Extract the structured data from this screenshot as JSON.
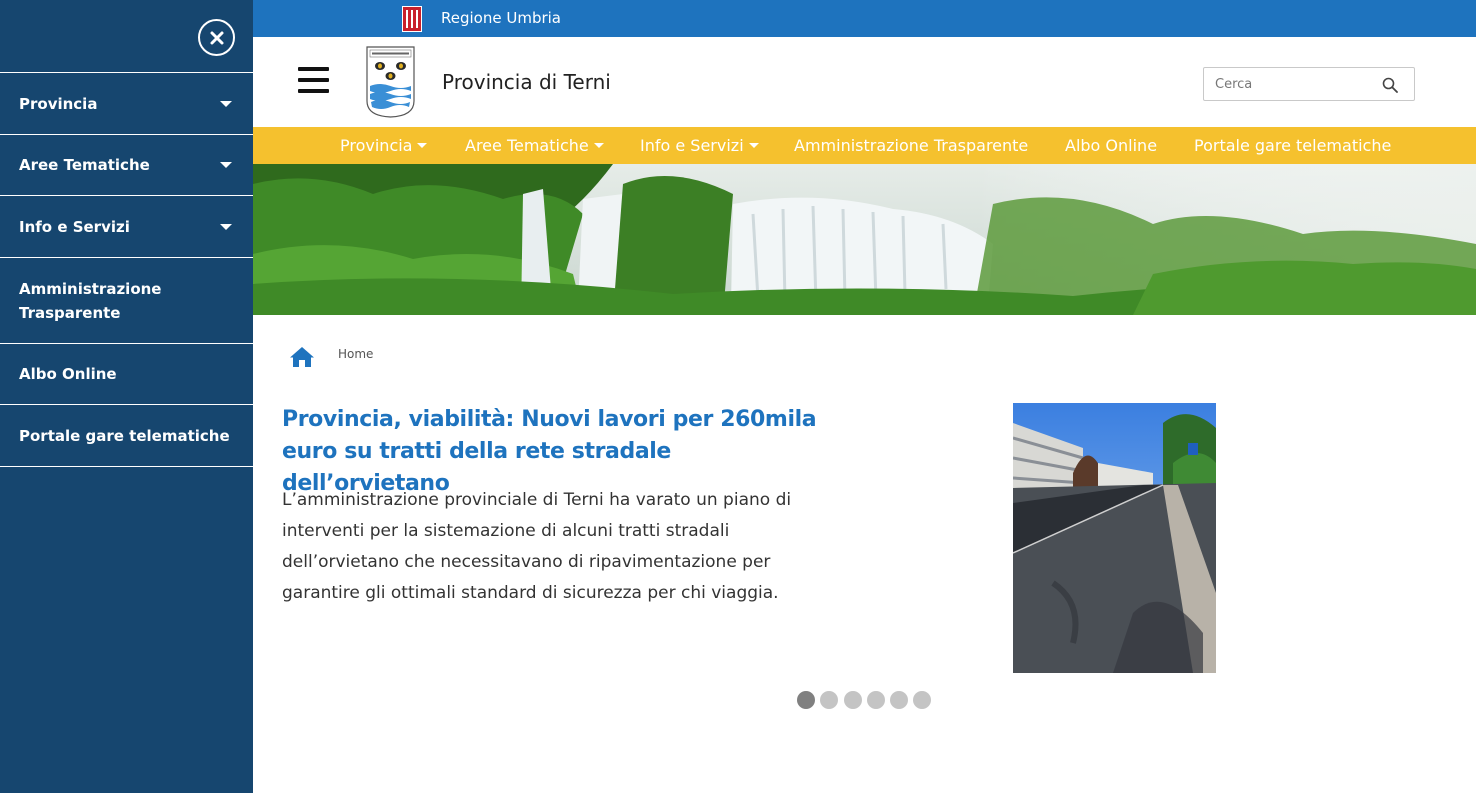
{
  "drawer": {
    "items": [
      {
        "label": "Provincia",
        "has_submenu": true
      },
      {
        "label": "Aree Tematiche",
        "has_submenu": true
      },
      {
        "label": "Info e Servizi",
        "has_submenu": true
      },
      {
        "label": "Amministrazione Trasparente",
        "has_submenu": false
      },
      {
        "label": "Albo Online",
        "has_submenu": false
      },
      {
        "label": "Portale gare telematiche",
        "has_submenu": false
      }
    ]
  },
  "region_bar": {
    "label": "Regione Umbria"
  },
  "header": {
    "site_title": "Provincia di Terni",
    "search_placeholder": "Cerca"
  },
  "main_nav": {
    "items": [
      {
        "label": "Provincia",
        "has_submenu": true
      },
      {
        "label": "Aree Tematiche",
        "has_submenu": true
      },
      {
        "label": "Info e Servizi",
        "has_submenu": true
      },
      {
        "label": "Amministrazione Trasparente",
        "has_submenu": false
      },
      {
        "label": "Albo Online",
        "has_submenu": false
      },
      {
        "label": "Portale gare telematiche",
        "has_submenu": false
      }
    ]
  },
  "breadcrumb": {
    "home_label": "Home"
  },
  "article": {
    "headline": "Provincia, viabilità: Nuovi lavori per 260mila euro su tratti della rete stradale dell’orvietano",
    "summary": "L’amministrazione provinciale di Terni ha varato un piano di interventi per la sistemazione di alcuni tratti stradali dell’orvietano che necessitavano di ripavimentazione per garantire gli ottimali standard di sicurezza per chi viaggia."
  },
  "slider": {
    "total": 6,
    "active_index": 0
  },
  "colors": {
    "drawer_bg": "#16466f",
    "region_bar": "#1e73be",
    "nav_bar": "#f5c12e",
    "headline": "#1e73be"
  },
  "icons": [
    "close-icon",
    "hamburger-icon",
    "search-icon",
    "home-icon",
    "chevron-down-icon"
  ]
}
